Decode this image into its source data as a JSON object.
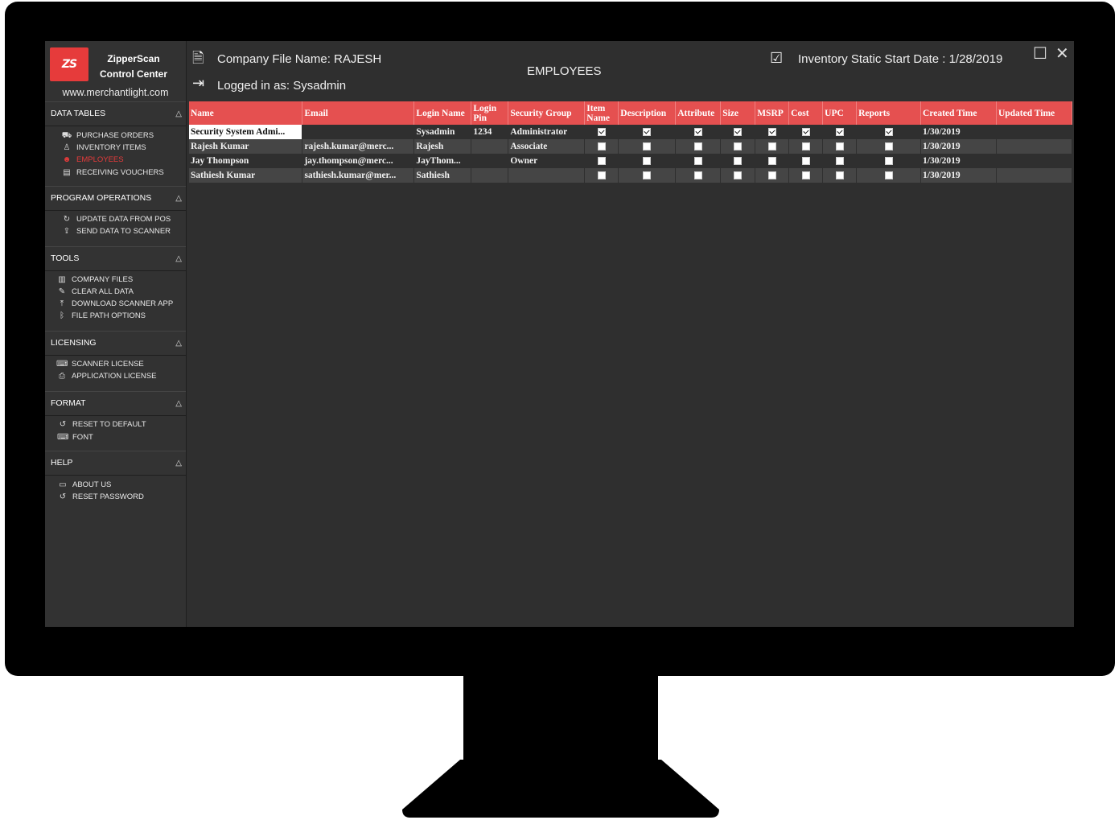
{
  "app": {
    "brand_line1": "ZipperScan",
    "brand_line2": "Control Center",
    "logo_text": "ZS",
    "website": "www.merchantlight.com",
    "accent": "#e63b3b"
  },
  "sidebar": {
    "sections": [
      {
        "title": "DATA TABLES",
        "items": [
          {
            "label": "PURCHASE ORDERS",
            "icon": "cart-icon"
          },
          {
            "label": "INVENTORY ITEMS",
            "icon": "hanger-icon"
          },
          {
            "label": "EMPLOYEES",
            "icon": "people-icon",
            "active": true
          },
          {
            "label": "RECEIVING VOUCHERS",
            "icon": "receipt-icon"
          }
        ]
      },
      {
        "title": "PROGRAM OPERATIONS",
        "items": [
          {
            "label": "UPDATE DATA FROM POS",
            "icon": "refresh-icon"
          },
          {
            "label": "SEND DATA TO SCANNER",
            "icon": "upload-icon"
          }
        ]
      },
      {
        "title": "TOOLS",
        "items": [
          {
            "label": "COMPANY FILES",
            "icon": "files-icon"
          },
          {
            "label": "CLEAR ALL DATA",
            "icon": "broom-icon"
          },
          {
            "label": "DOWNLOAD SCANNER APP",
            "icon": "download-icon"
          },
          {
            "label": "FILE PATH OPTIONS",
            "icon": "bluetooth-icon"
          }
        ]
      },
      {
        "title": "LICENSING",
        "items": [
          {
            "label": "SCANNER LICENSE",
            "icon": "scanner-icon"
          },
          {
            "label": "APPLICATION LICENSE",
            "icon": "license-icon"
          }
        ]
      },
      {
        "title": "FORMAT",
        "items": [
          {
            "label": "RESET TO DEFAULT",
            "icon": "reset-icon"
          },
          {
            "label": "FONT",
            "icon": "font-icon"
          }
        ]
      },
      {
        "title": "HELP",
        "items": [
          {
            "label": "ABOUT US",
            "icon": "info-icon"
          },
          {
            "label": "RESET PASSWORD",
            "icon": "reset-icon"
          }
        ]
      }
    ]
  },
  "header": {
    "company_file": "Company File Name:  RAJESH",
    "logged_in": "Logged in as: Sysadmin",
    "title": "EMPLOYEES",
    "inventory_date": "Inventory Static Start Date :  1/28/2019"
  },
  "table": {
    "columns": [
      "Name",
      "Email",
      "Login Name",
      "Login Pin",
      "Security Group",
      "Item Name",
      "Description",
      "Attribute",
      "Size",
      "MSRP",
      "Cost",
      "UPC",
      "Reports",
      "Created Time",
      "Updated Time"
    ],
    "rows": [
      {
        "name": "Security System Admi...",
        "email": "",
        "login": "Sysadmin",
        "pin": "1234",
        "group": "Administrator",
        "checks": [
          true,
          true,
          true,
          true,
          true,
          true,
          true,
          true
        ],
        "created": "1/30/2019",
        "updated": ""
      },
      {
        "name": "Rajesh Kumar",
        "email": "rajesh.kumar@merc...",
        "login": "Rajesh",
        "pin": "",
        "group": "Associate",
        "checks": [
          false,
          false,
          false,
          false,
          false,
          false,
          false,
          false
        ],
        "created": "1/30/2019",
        "updated": ""
      },
      {
        "name": "Jay Thompson",
        "email": "jay.thompson@merc...",
        "login": "JayThom...",
        "pin": "",
        "group": "Owner",
        "checks": [
          false,
          false,
          false,
          false,
          false,
          false,
          false,
          false
        ],
        "created": "1/30/2019",
        "updated": ""
      },
      {
        "name": "Sathiesh Kumar",
        "email": "sathiesh.kumar@mer...",
        "login": "Sathiesh",
        "pin": "",
        "group": "",
        "checks": [
          false,
          false,
          false,
          false,
          false,
          false,
          false,
          false
        ],
        "created": "1/30/2019",
        "updated": ""
      }
    ]
  }
}
